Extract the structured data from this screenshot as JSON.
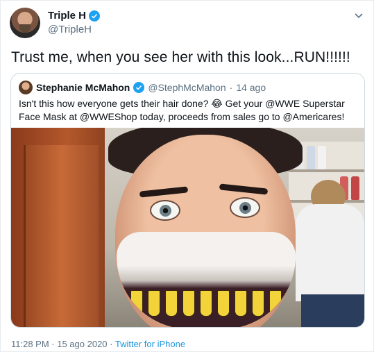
{
  "author": {
    "name": "Triple H",
    "handle": "@TripleH"
  },
  "tweet": {
    "text": "Trust me, when you see her with this look...RUN!!!!!!"
  },
  "quoted": {
    "name": "Stephanie McMahon",
    "handle": "@StephMcMahon",
    "separator": "·",
    "time": "14 ago",
    "text": "Isn't this how everyone gets their hair done? 😂 Get your @WWE Superstar Face Mask at @WWEShop today, proceeds from sales go to @Americares!"
  },
  "footer": {
    "timestamp": "11:28 PM · 15 ago 2020",
    "separator": "·",
    "source": "Twitter for iPhone"
  },
  "icons": {
    "verified": "verified-badge-icon",
    "menu": "chevron-down-icon"
  },
  "colors": {
    "accent": "#1da1f2",
    "link": "#1b95e0",
    "muted": "#5b7083"
  }
}
